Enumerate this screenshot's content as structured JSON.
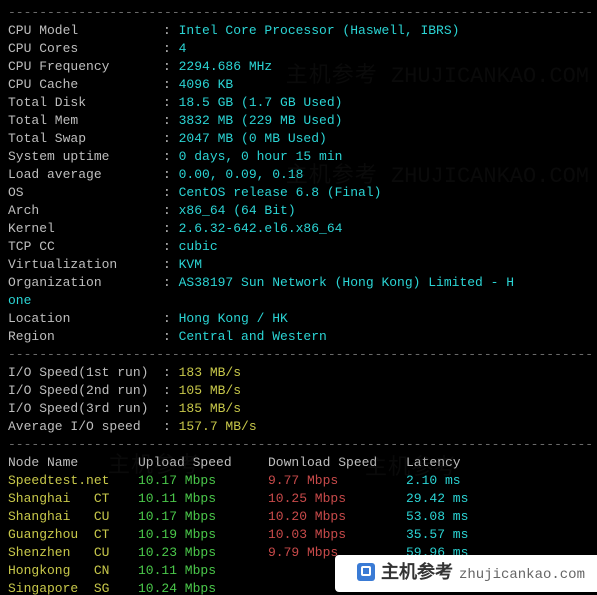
{
  "dash": "---------------------------------------------------------------------------",
  "sys": [
    {
      "k": "CPU Model",
      "v": "Intel Core Processor (Haswell, IBRS)"
    },
    {
      "k": "CPU Cores",
      "v": "4"
    },
    {
      "k": "CPU Frequency",
      "v": "2294.686 MHz"
    },
    {
      "k": "CPU Cache",
      "v": "4096 KB"
    },
    {
      "k": "Total Disk",
      "v": "18.5 GB (1.7 GB Used)"
    },
    {
      "k": "Total Mem",
      "v": "3832 MB (229 MB Used)"
    },
    {
      "k": "Total Swap",
      "v": "2047 MB (0 MB Used)"
    },
    {
      "k": "System uptime",
      "v": "0 days, 0 hour 15 min"
    },
    {
      "k": "Load average",
      "v": "0.00, 0.09, 0.18"
    },
    {
      "k": "OS",
      "v": "CentOS release 6.8 (Final)"
    },
    {
      "k": "Arch",
      "v": "x86_64 (64 Bit)"
    },
    {
      "k": "Kernel",
      "v": "2.6.32-642.el6.x86_64"
    },
    {
      "k": "TCP CC",
      "v": "cubic"
    },
    {
      "k": "Virtualization",
      "v": "KVM"
    }
  ],
  "org": {
    "k": "Organization",
    "v": "AS38197 Sun Network (Hong Kong) Limited - H",
    "trail": "one"
  },
  "loc": [
    {
      "k": "Location",
      "v": "Hong Kong / HK"
    },
    {
      "k": "Region",
      "v": "Central and Western"
    }
  ],
  "io": [
    {
      "k": "I/O Speed(1st run)",
      "v": "183 MB/s"
    },
    {
      "k": "I/O Speed(2nd run)",
      "v": "105 MB/s"
    },
    {
      "k": "I/O Speed(3rd run)",
      "v": "185 MB/s"
    },
    {
      "k": "Average I/O speed",
      "v": "157.7 MB/s"
    }
  ],
  "hdr": {
    "node": "Node Name",
    "up": "Upload Speed",
    "dn": "Download Speed",
    "lat": "Latency"
  },
  "nodes": [
    {
      "n": "Speedtest.net",
      "u": "10.17 Mbps",
      "d": "9.77 Mbps",
      "l": "2.10 ms"
    },
    {
      "n": "Shanghai   CT",
      "u": "10.11 Mbps",
      "d": "10.25 Mbps",
      "l": "29.42 ms"
    },
    {
      "n": "Shanghai   CU",
      "u": "10.17 Mbps",
      "d": "10.20 Mbps",
      "l": "53.08 ms"
    },
    {
      "n": "Guangzhou  CT",
      "u": "10.19 Mbps",
      "d": "10.03 Mbps",
      "l": "35.57 ms"
    },
    {
      "n": "Shenzhen   CU",
      "u": "10.23 Mbps",
      "d": "9.79 Mbps",
      "l": "59.96 ms"
    },
    {
      "n": "Hongkong   CN",
      "u": "10.11 Mbps",
      "d": "",
      "l": ""
    },
    {
      "n": "Singapore  SG",
      "u": "10.24 Mbps",
      "d": "",
      "l": ""
    }
  ],
  "wm": {
    "cn": "主机参考",
    "en": "ZHUJICANKAO.COM",
    "dom": "zhujicankao.com"
  }
}
